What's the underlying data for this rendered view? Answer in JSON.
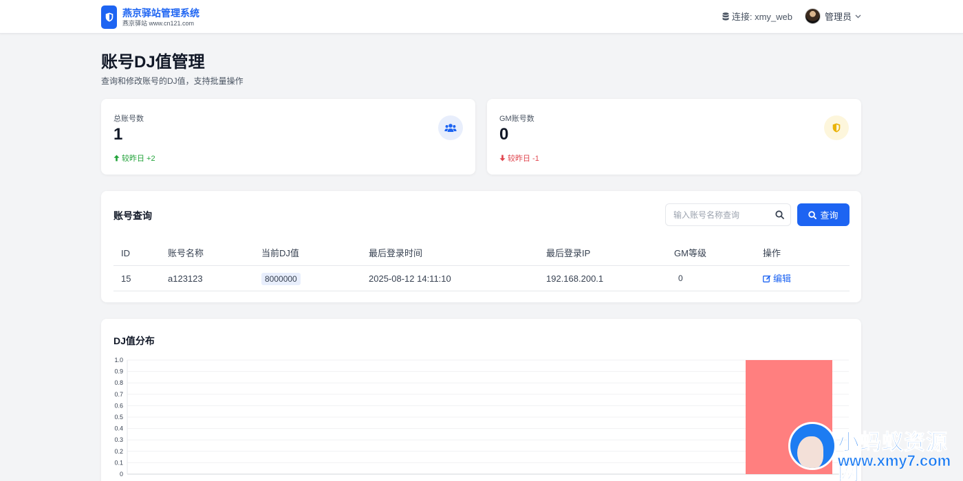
{
  "brand": {
    "title": "燕京驿站管理系统",
    "subtitle": "燕京驿站 www.cn121.com"
  },
  "navbar": {
    "connection": "连接: xmy_web",
    "user": "管理员"
  },
  "page": {
    "title": "账号DJ值管理",
    "description": "查询和修改账号的DJ值，支持批量操作"
  },
  "stats": [
    {
      "label": "总账号数",
      "value": "1",
      "change": "较昨日 +2",
      "direction": "up",
      "color": "#22a33a",
      "icon": "users-icon",
      "icon_color": "#1d64f2",
      "icon_bg": "#e8eefc"
    },
    {
      "label": "GM账号数",
      "value": "0",
      "change": "较昨日 -1",
      "direction": "down",
      "color": "#e0454e",
      "icon": "shield-icon",
      "icon_color": "#eab308",
      "icon_bg": "#fdf6dc"
    }
  ],
  "query": {
    "title": "账号查询",
    "search_placeholder": "输入账号名称查询",
    "button_label": "查询",
    "columns": [
      "ID",
      "账号名称",
      "当前DJ值",
      "最后登录时间",
      "最后登录IP",
      "GM等级",
      "操作"
    ],
    "rows": [
      {
        "id": "15",
        "name": "a123123",
        "dj": "8000000",
        "last_login": "2025-08-12 14:11:10",
        "ip": "192.168.200.1",
        "gm": "0",
        "action": "编辑"
      }
    ]
  },
  "chart": {
    "title": "DJ值分布"
  },
  "chart_data": {
    "type": "bar",
    "categories": [
      ""
    ],
    "values": [
      1
    ],
    "title": "DJ值分布",
    "xlabel": "",
    "ylabel": "",
    "ylim": [
      0,
      1.0
    ],
    "yticks": [
      "0",
      "0.1",
      "0.2",
      "0.3",
      "0.4",
      "0.5",
      "0.6",
      "0.7",
      "0.8",
      "0.9",
      "1.0"
    ],
    "bar_color": "#ff7f7f",
    "grid": true
  },
  "watermark": {
    "title": "小蚂蚁资源网",
    "url": "www.xmy7.com"
  },
  "colors": {
    "primary": "#1d64f2",
    "up": "#22a33a",
    "down": "#e0454e"
  }
}
